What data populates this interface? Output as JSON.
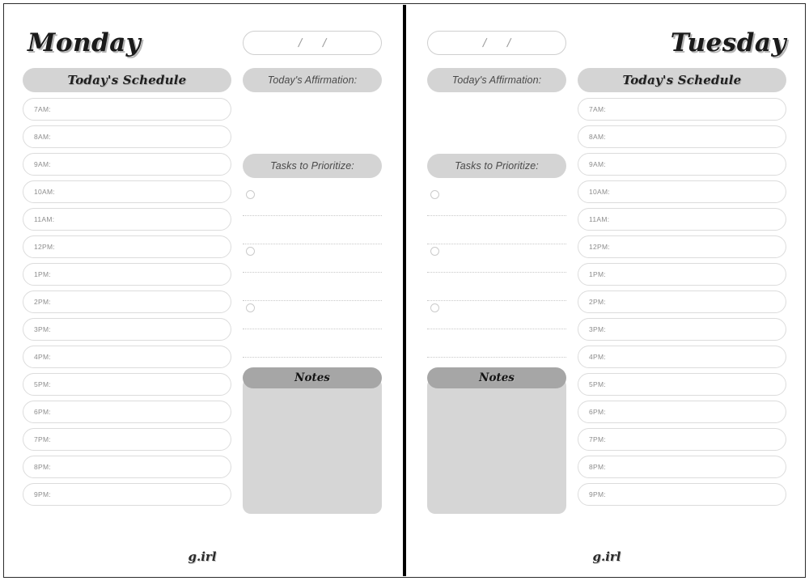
{
  "pages": [
    {
      "day_title": "Monday",
      "layout": "schedule-left",
      "date_field": {
        "separator_1": "/",
        "separator_2": "/",
        "value": ""
      },
      "schedule": {
        "heading": "Today's Schedule",
        "slots": [
          {
            "label": "7AM:",
            "value": ""
          },
          {
            "label": "8AM:",
            "value": ""
          },
          {
            "label": "9AM:",
            "value": ""
          },
          {
            "label": "10AM:",
            "value": ""
          },
          {
            "label": "11AM:",
            "value": ""
          },
          {
            "label": "12PM:",
            "value": ""
          },
          {
            "label": "1PM:",
            "value": ""
          },
          {
            "label": "2PM:",
            "value": ""
          },
          {
            "label": "3PM:",
            "value": ""
          },
          {
            "label": "4PM:",
            "value": ""
          },
          {
            "label": "5PM:",
            "value": ""
          },
          {
            "label": "6PM:",
            "value": ""
          },
          {
            "label": "7PM:",
            "value": ""
          },
          {
            "label": "8PM:",
            "value": ""
          },
          {
            "label": "9PM:",
            "value": ""
          }
        ]
      },
      "affirmation": {
        "heading": "Today's Affirmation:",
        "value": ""
      },
      "tasks": {
        "heading": "Tasks to Prioritize:",
        "rows": [
          {
            "bubble": true,
            "value": ""
          },
          {
            "bubble": false,
            "value": ""
          },
          {
            "bubble": true,
            "value": ""
          },
          {
            "bubble": false,
            "value": ""
          },
          {
            "bubble": true,
            "value": ""
          },
          {
            "bubble": false,
            "value": ""
          }
        ]
      },
      "notes": {
        "heading": "Notes",
        "value": ""
      },
      "brand": "g.irl"
    },
    {
      "day_title": "Tuesday",
      "layout": "schedule-right",
      "date_field": {
        "separator_1": "/",
        "separator_2": "/",
        "value": ""
      },
      "schedule": {
        "heading": "Today's Schedule",
        "slots": [
          {
            "label": "7AM:",
            "value": ""
          },
          {
            "label": "8AM:",
            "value": ""
          },
          {
            "label": "9AM:",
            "value": ""
          },
          {
            "label": "10AM:",
            "value": ""
          },
          {
            "label": "11AM:",
            "value": ""
          },
          {
            "label": "12PM:",
            "value": ""
          },
          {
            "label": "1PM:",
            "value": ""
          },
          {
            "label": "2PM:",
            "value": ""
          },
          {
            "label": "3PM:",
            "value": ""
          },
          {
            "label": "4PM:",
            "value": ""
          },
          {
            "label": "5PM:",
            "value": ""
          },
          {
            "label": "6PM:",
            "value": ""
          },
          {
            "label": "7PM:",
            "value": ""
          },
          {
            "label": "8PM:",
            "value": ""
          },
          {
            "label": "9PM:",
            "value": ""
          }
        ]
      },
      "affirmation": {
        "heading": "Today's Affirmation:",
        "value": ""
      },
      "tasks": {
        "heading": "Tasks to Prioritize:",
        "rows": [
          {
            "bubble": true,
            "value": ""
          },
          {
            "bubble": false,
            "value": ""
          },
          {
            "bubble": true,
            "value": ""
          },
          {
            "bubble": false,
            "value": ""
          },
          {
            "bubble": true,
            "value": ""
          },
          {
            "bubble": false,
            "value": ""
          }
        ]
      },
      "notes": {
        "heading": "Notes",
        "value": ""
      },
      "brand": "g.irl"
    }
  ],
  "colors": {
    "pill_header": "#d4d4d4",
    "notes_header": "#a6a6a6",
    "notes_body": "#d6d6d6",
    "slot_border": "#dcdcdc",
    "label_text": "#8d8d8d",
    "frame": "#2b2b2b",
    "gutter": "#000000"
  }
}
